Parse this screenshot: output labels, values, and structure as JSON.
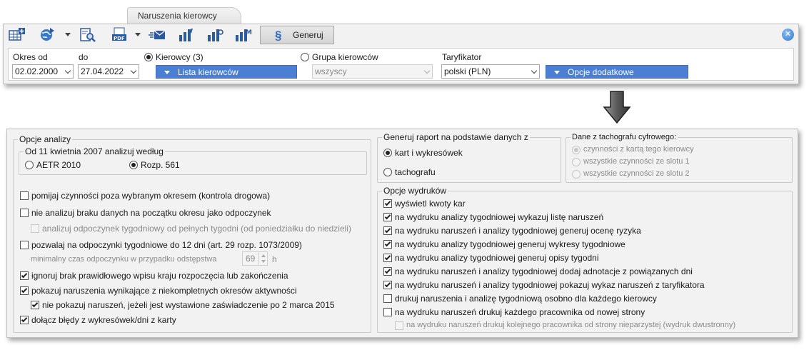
{
  "tab": {
    "title": "Naruszenia kierowcy"
  },
  "toolbar": {
    "icons": [
      "add-table-icon",
      "globe-icon",
      "search-report-icon",
      "pdf-icon",
      "email-icon",
      "chart-icon",
      "chart-alt-icon",
      "chart-m-icon"
    ],
    "generate_label": "Generuj",
    "generate_icon": "§"
  },
  "filters": {
    "period_from_label": "Okres od",
    "period_from_value": "02.02.2000",
    "period_to_label": "do",
    "period_to_value": "27.04.2022",
    "drivers_radio_label": "Kierowcy (3)",
    "drivers_list_button": "Lista kierowców",
    "group_radio_label": "Grupa kierowców",
    "group_value": "wszyscy",
    "tariff_label": "Taryfikator",
    "tariff_value": "polski (PLN)",
    "extra_options_button": "Opcje dodatkowe"
  },
  "analysis": {
    "title": "Opcje analizy",
    "since_group_title": "Od 11 kwietnia 2007 analizuj według",
    "aetr_label": "AETR 2010",
    "rozp_label": "Rozp. 561",
    "opt1": "pomijaj czynności poza wybranym okresem (kontrola drogowa)",
    "opt2": "nie analizuj braku danych na początku okresu jako odpoczynek",
    "opt2_sub": "analizuj odpoczynek tygodniowy od pełnych tygodni (od poniedziałku do niedzieli)",
    "opt3": "pozwalaj na odpoczynki tygodniowe do 12 dni (art. 29 rozp. 1073/2009)",
    "min_rest_label": "minimalny czas odpoczynku w przypadku odstępstwa",
    "min_rest_value": "69",
    "min_rest_unit": "h",
    "opt4": "ignoruj brak prawidłowego wpisu kraju rozpoczęcia lub zakończenia",
    "opt5": "pokazuj naruszenia wynikające z niekompletnych okresów aktywności",
    "opt5_sub": "nie pokazuj naruszeń, jeżeli jest wystawione zaświadczenie po 2 marca 2015",
    "opt6": "dołącz błędy z wykresówek/dni z karty"
  },
  "source": {
    "title": "Generuj raport na podstawie danych z",
    "opt_cards": "kart i wykresówek",
    "opt_tacho": "tachografu"
  },
  "digital": {
    "title": "Dane z tachografu cyfrowego:",
    "opt1": "czynności z kartą tego kierowcy",
    "opt2": "wszystkie czynności ze slotu 1",
    "opt3": "wszystkie czynności ze slotu 2"
  },
  "prints": {
    "title": "Opcje wydruków",
    "items": [
      "wyświetl kwoty kar",
      "na wydruku analizy tygodniowej wykazuj listę naruszeń",
      "na wydruku naruszeń i analizy tygodniowej generuj ocenę ryzyka",
      "na wydruku analizy tygodniowej generuj wykresy tygodniowe",
      "na wydruku analizy tygodniowej generuj opisy tygodni",
      "na wydruku naruszeń i analizy tygodniowej dodaj adnotacje z powiązanych dni",
      "na wydruku naruszeń i analizy tygodniowej pokazuj wykaz naruszeń z taryfikatora",
      "drukuj naruszenia i analizę tygodniową osobno dla każdego kierowcy",
      "na wydruku naruszeń drukuj każdego pracownika od nowej strony",
      "na wydruku naruszeń drukuj kolejnego pracownika od strony nieparzystej (wydruk dwustronny)"
    ]
  },
  "colors": {
    "accent": "#4a7fd3",
    "panel": "#f2f2f2",
    "border": "#bfbfbf"
  }
}
